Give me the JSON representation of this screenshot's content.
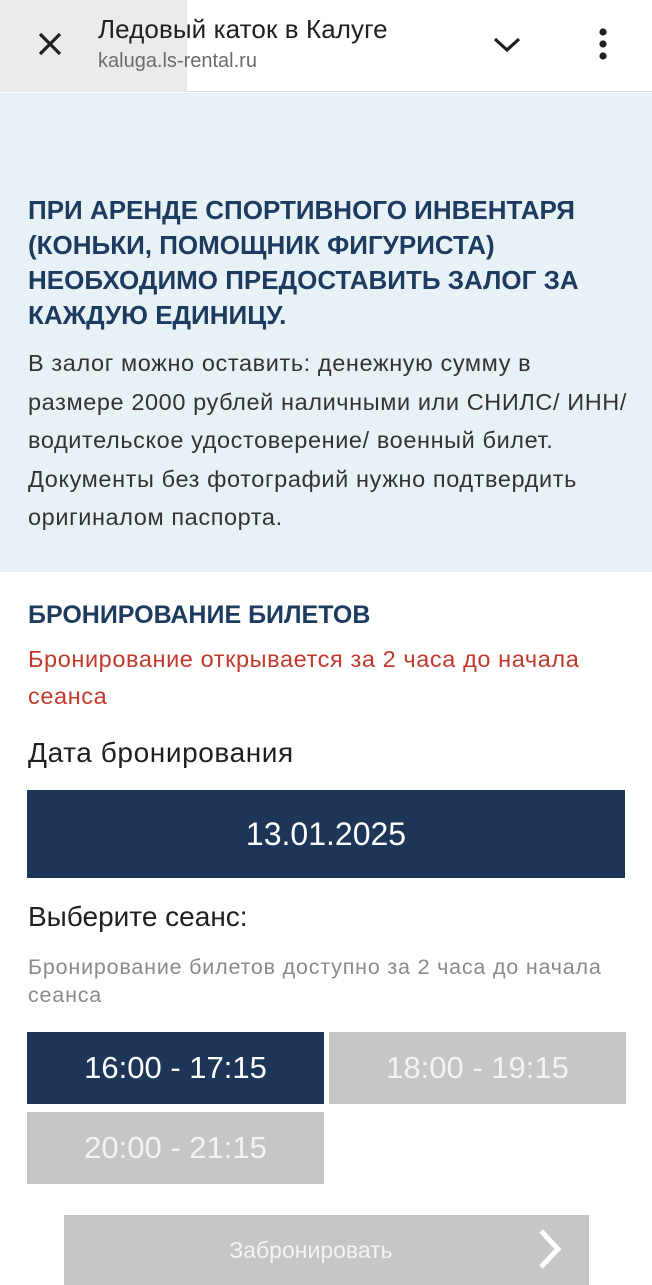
{
  "header": {
    "title": "Ледовый каток в Калуге",
    "url": "kaluga.ls-rental.ru",
    "icons": {
      "close": "close-icon",
      "expand": "chevron-down-icon",
      "menu": "more-vert-icon"
    }
  },
  "notice": {
    "heading": "ПРИ АРЕНДЕ СПОРТИВНОГО ИНВЕНТАРЯ (КОНЬКИ, ПОМОЩНИК ФИГУРИСТА) НЕОБХОДИМО ПРЕДОСТАВИТЬ ЗАЛОГ ЗА КАЖДУЮ ЕДИНИЦУ.",
    "body": "В залог можно оставить: денежную сумму в размере 2000 рублей наличными или СНИЛС/ ИНН/ водительское удостоверение/ военный билет. Документы без фотографий нужно подтвердить оригиналом паспорта."
  },
  "booking": {
    "title": "БРОНИРОВАНИЕ БИЛЕТОВ",
    "warning": "Бронирование открывается за 2 часа до начала сеанса",
    "date_label": "Дата бронирования",
    "date_value": "13.01.2025",
    "session_label": "Выберите сеанс:",
    "session_hint": "Бронирование билетов доступно за 2 часа до начала сеанса",
    "slots": [
      {
        "label": "16:00 - 17:15",
        "state": "selected"
      },
      {
        "label": "18:00 - 19:15",
        "state": "disabled"
      },
      {
        "label": "20:00 - 21:15",
        "state": "disabled"
      }
    ],
    "submit_label": "Забронировать",
    "submit_icon": "chevron-right-icon"
  },
  "colors": {
    "navy": "#1d3557",
    "heading_blue": "#1d3a5f",
    "notice_bg": "#e8f1f6",
    "warning_red": "#c0392b",
    "disabled_gray": "#c6c6c6"
  }
}
